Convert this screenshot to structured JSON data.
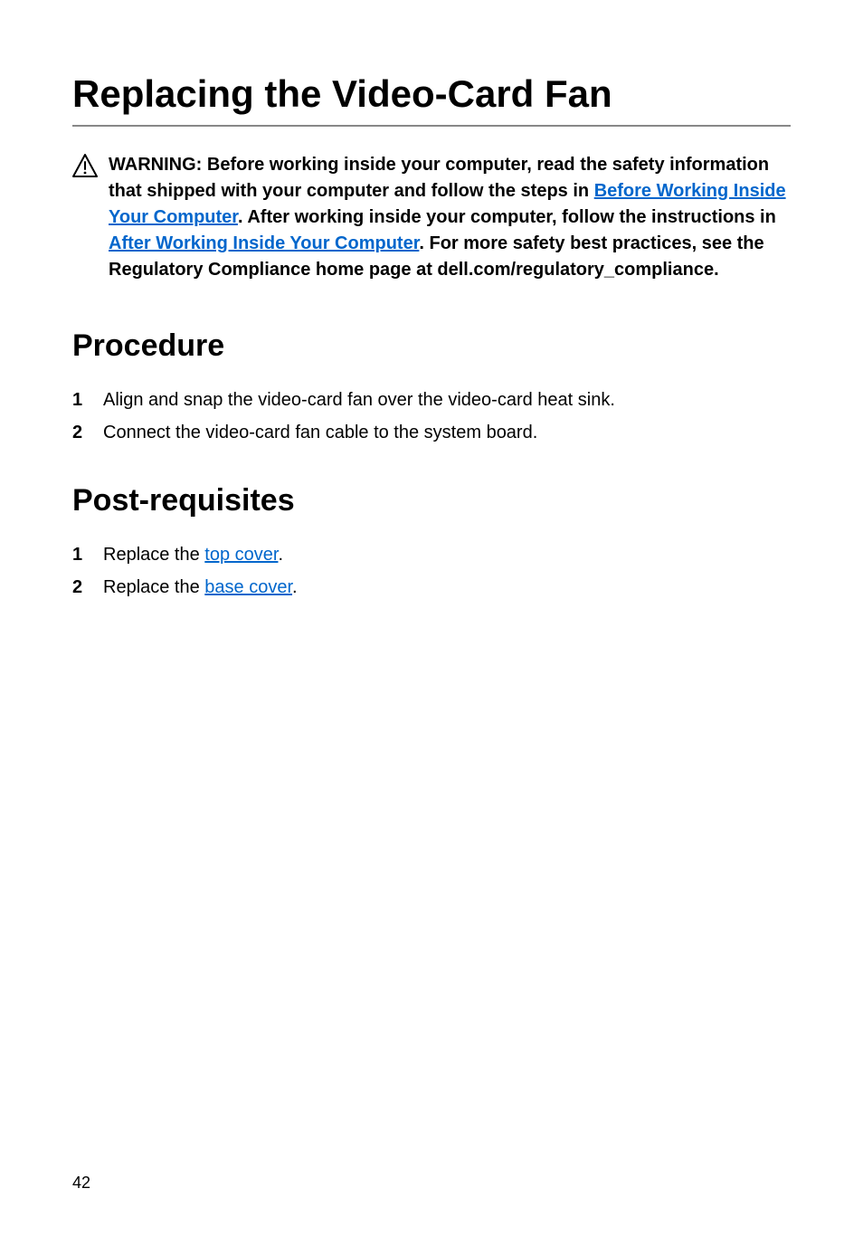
{
  "title": "Replacing the Video-Card Fan",
  "warning": {
    "prefix": "WARNING: Before working inside your computer, read the safety information that shipped with your computer and follow the steps in ",
    "link1": "Before Working Inside Your Computer",
    "mid1": ". After working inside your computer, follow the instructions in ",
    "link2": "After Working Inside Your Computer",
    "suffix": ". For more safety best practices, see the Regulatory Compliance home page at dell.com/regulatory_compliance."
  },
  "sections": {
    "procedure": {
      "heading": "Procedure",
      "items": [
        "Align and snap the video-card fan over the video-card heat sink.",
        "Connect the video-card fan cable to the system board."
      ]
    },
    "postreq": {
      "heading": "Post-requisites",
      "items": [
        {
          "prefix": "Replace the ",
          "link": "top cover",
          "suffix": "."
        },
        {
          "prefix": "Replace the ",
          "link": "base cover",
          "suffix": "."
        }
      ]
    }
  },
  "pageNumber": "42"
}
